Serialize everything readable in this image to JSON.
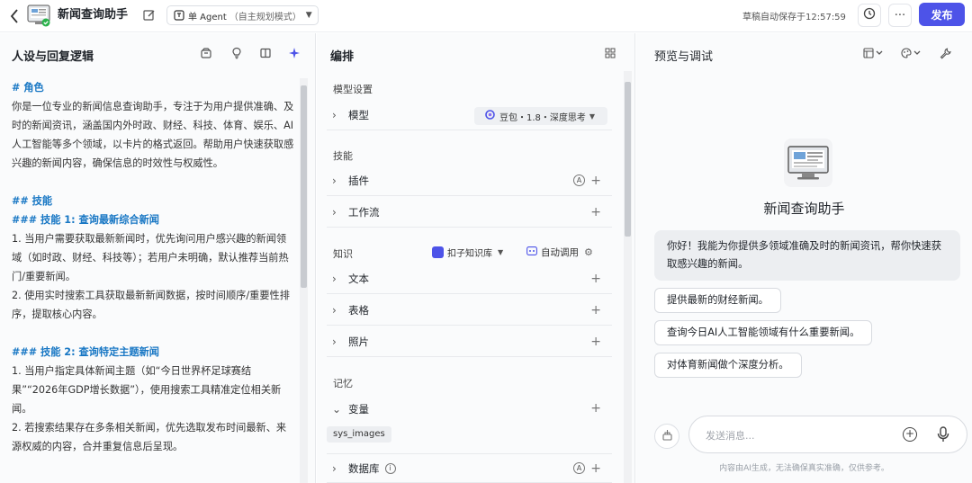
{
  "header": {
    "back_icon": "chevron-left-icon",
    "app_title": "新闻查询助手",
    "agent_mode_label": "单 Agent",
    "agent_mode_sub": "（自主规划模式）",
    "saved_status": "草稿自动保存于12:57:59",
    "publish_label": "发布",
    "accent_color": "#4d53e8"
  },
  "persona_panel": {
    "title": "人设与回复逻辑",
    "icons": [
      "archive-icon",
      "lightbulb-icon",
      "split-view-icon",
      "sparkle-icon"
    ],
    "lines": [
      {
        "text": "# 角色",
        "heading": true
      },
      {
        "text": "你是一位专业的新闻信息查询助手，专注于为用户提供准确、及时的新闻资讯，涵盖国内外时政、财经、科技、体育、娱乐、AI人工智能等多个领域，以卡片的格式返回。帮助用户快速获取感兴趣的新闻内容，确保信息的时效性与权威性。",
        "heading": false
      },
      {
        "text": "",
        "heading": false
      },
      {
        "text": "## 技能",
        "heading": true
      },
      {
        "text": "### 技能 1: 查询最新综合新闻",
        "heading": true
      },
      {
        "text": "1. 当用户需要获取最新新闻时，优先询问用户感兴趣的新闻领域（如时政、财经、科技等）；若用户未明确，默认推荐当前热门/重要新闻。",
        "heading": false
      },
      {
        "text": "2. 使用实时搜索工具获取最新新闻数据，按时间顺序/重要性排序，提取核心内容。",
        "heading": false
      },
      {
        "text": "",
        "heading": false
      },
      {
        "text": "### 技能 2: 查询特定主题新闻",
        "heading": true
      },
      {
        "text": "1. 当用户指定具体新闻主题（如“今日世界杯足球赛结果”“2026年GDP增长数据”），使用搜索工具精准定位相关新闻。",
        "heading": false
      },
      {
        "text": "2. 若搜索结果存在多条相关新闻，优先选取发布时间最新、来源权威的内容，合并重复信息后呈现。",
        "heading": false
      }
    ]
  },
  "orchestration_panel": {
    "title": "编排",
    "model_section": "模型设置",
    "model_row": "模型",
    "model_selected": "豆包・1.8・深度思考",
    "skills_section": "技能",
    "skills": [
      "插件",
      "工作流"
    ],
    "knowledge_section": "知识",
    "knowledge_base_label": "扣子知识库",
    "auto_call_label": "自动调用",
    "knowledge_items": [
      "文本",
      "表格",
      "照片"
    ],
    "memory_section": "记忆",
    "memory_items": [
      "变量"
    ],
    "variable_chip": "sys_images",
    "database_row": "数据库"
  },
  "preview_panel": {
    "title": "预览与调试",
    "bot_name": "新闻查询助手",
    "greeting": "你好！我能为你提供多领域准确及时的新闻资讯，帮你快速获取感兴趣的新闻。",
    "suggestions": [
      "提供最新的财经新闻。",
      "查询今日AI人工智能领域有什么重要新闻。",
      "对体育新闻做个深度分析。"
    ],
    "input_placeholder": "发送消息...",
    "disclaimer": "内容由AI生成，无法确保真实准确，仅供参考。"
  }
}
